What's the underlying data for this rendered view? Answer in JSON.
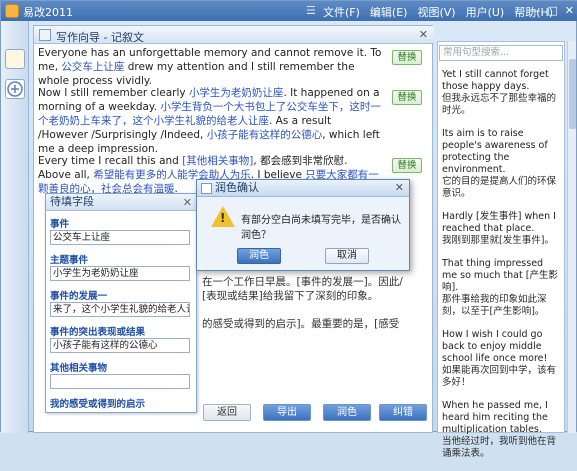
{
  "app": {
    "title": "易改2011",
    "sep": "☰",
    "menu": [
      "文件(F)",
      "编辑(E)",
      "视图(V)",
      "用户(U)",
      "帮助(H)"
    ]
  },
  "doc": {
    "title": "写作向导 - 记叙文",
    "paragraphs": [
      {
        "en": "Everyone has an unforgettable memory and cannot remove it. To me, ",
        "cn": "公交车上让座",
        "en2": " drew my attention and I still remember the whole process vividly."
      },
      {
        "en": "Now I still remember clearly ",
        "cn": "小学生为老奶奶让座",
        "en2": ". It happened on a morning of a weekday. ",
        "cn2": "小学生背负一个大书包上了公交车坐下，这时一个老奶奶上车来了，这个小学生礼貌的给老人让座",
        "en3": ". As a result /However /Surprisingly /Indeed, ",
        "cn3": "小孩子能有这样的公德心",
        "en4": ", which left me a deep impression."
      },
      {
        "en": "Every time I recall this and ",
        "cn": "[其他相关事物]",
        "en2": ", 都会感到非常欣慰. Above all, ",
        "cn2": "希望能有更多的人能学会助人为乐",
        "en3": ". I believe ",
        "cn3": "只要大家都有一颗善良的心，社会总会有温暖",
        "en4": "."
      }
    ],
    "replace_label": "替换",
    "bottom_lines": [
      "在一个工作日早晨。[事件的发展一]。因此/",
      "[表现或结果]给我留下了深刻的印象。",
      "的感受或得到的启示]。最重要的是，[感受"
    ],
    "buttons": [
      "返回",
      "导出",
      "润色",
      "纠错"
    ]
  },
  "fill_panel": {
    "title": "待填字段",
    "fields": [
      {
        "label": "事件",
        "value": "公交车上让座"
      },
      {
        "label": "主题事件",
        "value": "小学生为老奶奶让座"
      },
      {
        "label": "事件的发展一",
        "value": "来了，这个小学生礼貌的给老人让座"
      },
      {
        "label": "事件的突出表现或结果",
        "value": "小孩子能有这样的公德心"
      },
      {
        "label": "其他相关事物",
        "value": ""
      },
      {
        "label": "我的感受或得到的启示",
        "value": ""
      }
    ]
  },
  "dialog": {
    "title": "润色确认",
    "message": "有部分空白尚未填写完毕，是否确认润色？",
    "ok": "润色",
    "cancel": "取消"
  },
  "right_panel": {
    "search_placeholder": "常用句型搜索...",
    "items": [
      {
        "en": "Yet I still cannot forget those happy days.",
        "zh": "但我永远忘不了那些幸福的时光。"
      },
      {
        "en": "Its aim is to raise people's awareness of protecting the environment.",
        "zh": "它的目的是提高人们的环保意识。"
      },
      {
        "en": "Hardly [发生事件] when I reached that place.",
        "zh": "我刚到那里就[发生事件]。"
      },
      {
        "en": "That thing impressed me so much that [产生影响].",
        "zh": "那件事给我的印象如此深刻，以至于[产生影响]。"
      },
      {
        "en": "How I wish I could go back to enjoy middle school life once more!",
        "zh": "如果能再次回到中学，该有多好！"
      },
      {
        "en": "When he passed me, I heard him reciting the multiplication tables.",
        "zh": "当他经过时，我听到他在背诵乘法表。"
      }
    ]
  }
}
